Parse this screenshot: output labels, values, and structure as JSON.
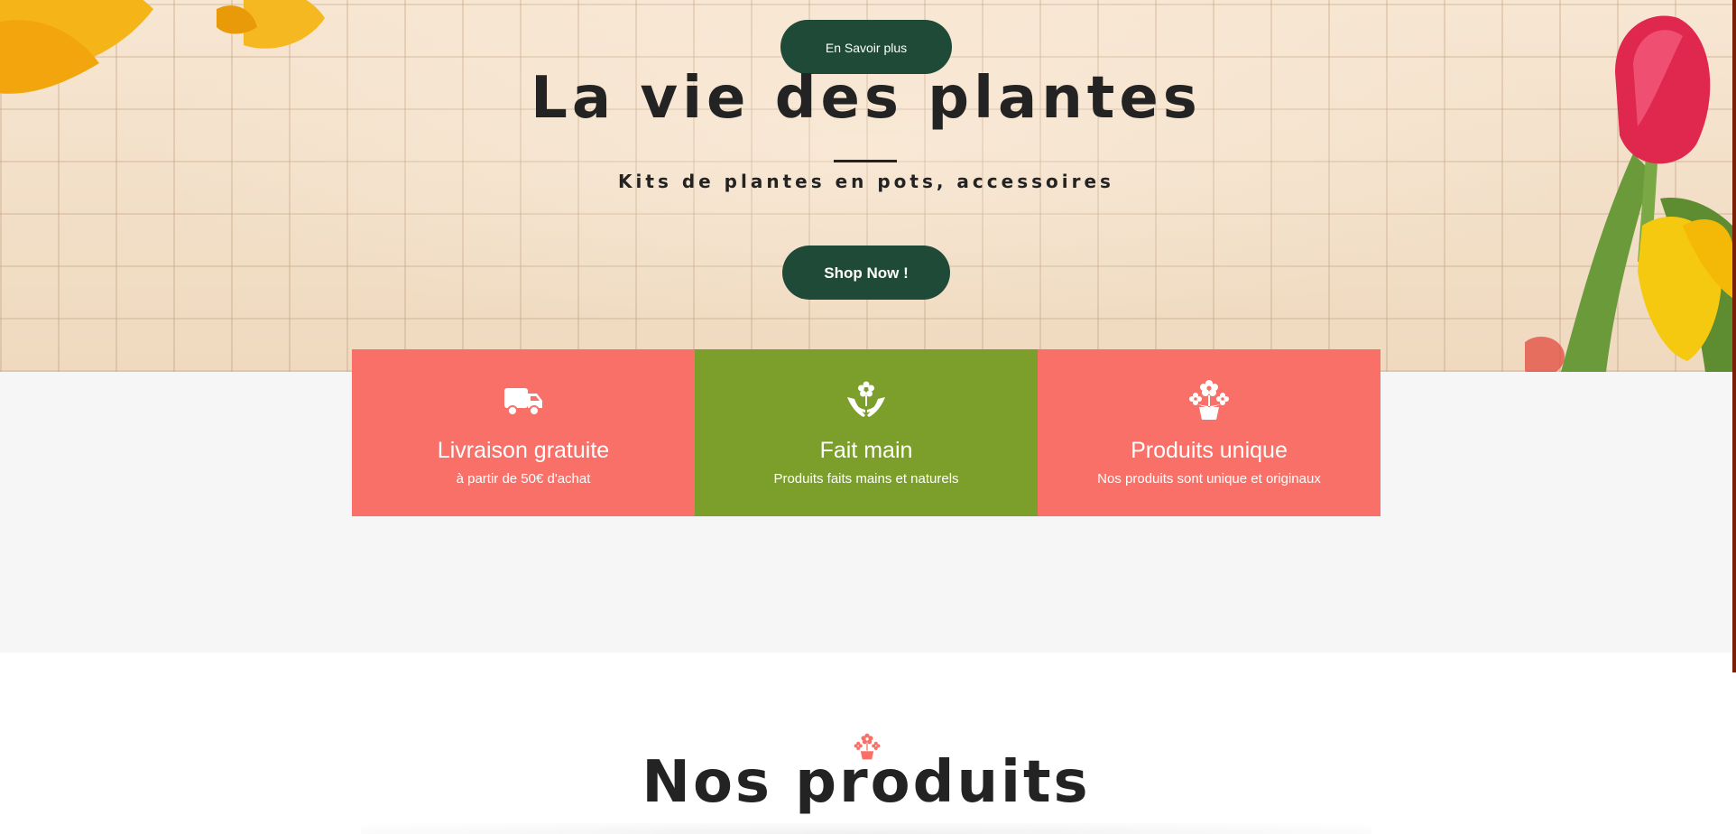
{
  "hero": {
    "learn_more_button": "En Savoir plus",
    "title": "La vie des plantes",
    "subtitle": "Kits de plantes en pots, accessoires",
    "shop_button": "Shop Now !"
  },
  "features": [
    {
      "icon": "truck-icon",
      "title": "Livraison gratuite",
      "description": "à partir de 50€ d'achat",
      "color": "#f87067"
    },
    {
      "icon": "hands-flower-icon",
      "title": "Fait main",
      "description": "Produits faits mains et naturels",
      "color": "#7c9e2b"
    },
    {
      "icon": "flower-pot-icon",
      "title": "Produits unique",
      "description": "Nos produits sont unique et originaux",
      "color": "#f87067"
    }
  ],
  "products": {
    "icon": "flower-pot-icon",
    "title": "Nos produits"
  },
  "colors": {
    "button_dark_green": "#1f4a37",
    "coral": "#f87067",
    "olive_green": "#7c9e2b",
    "section_gray": "#f6f6f6",
    "text_dark": "#232323"
  }
}
